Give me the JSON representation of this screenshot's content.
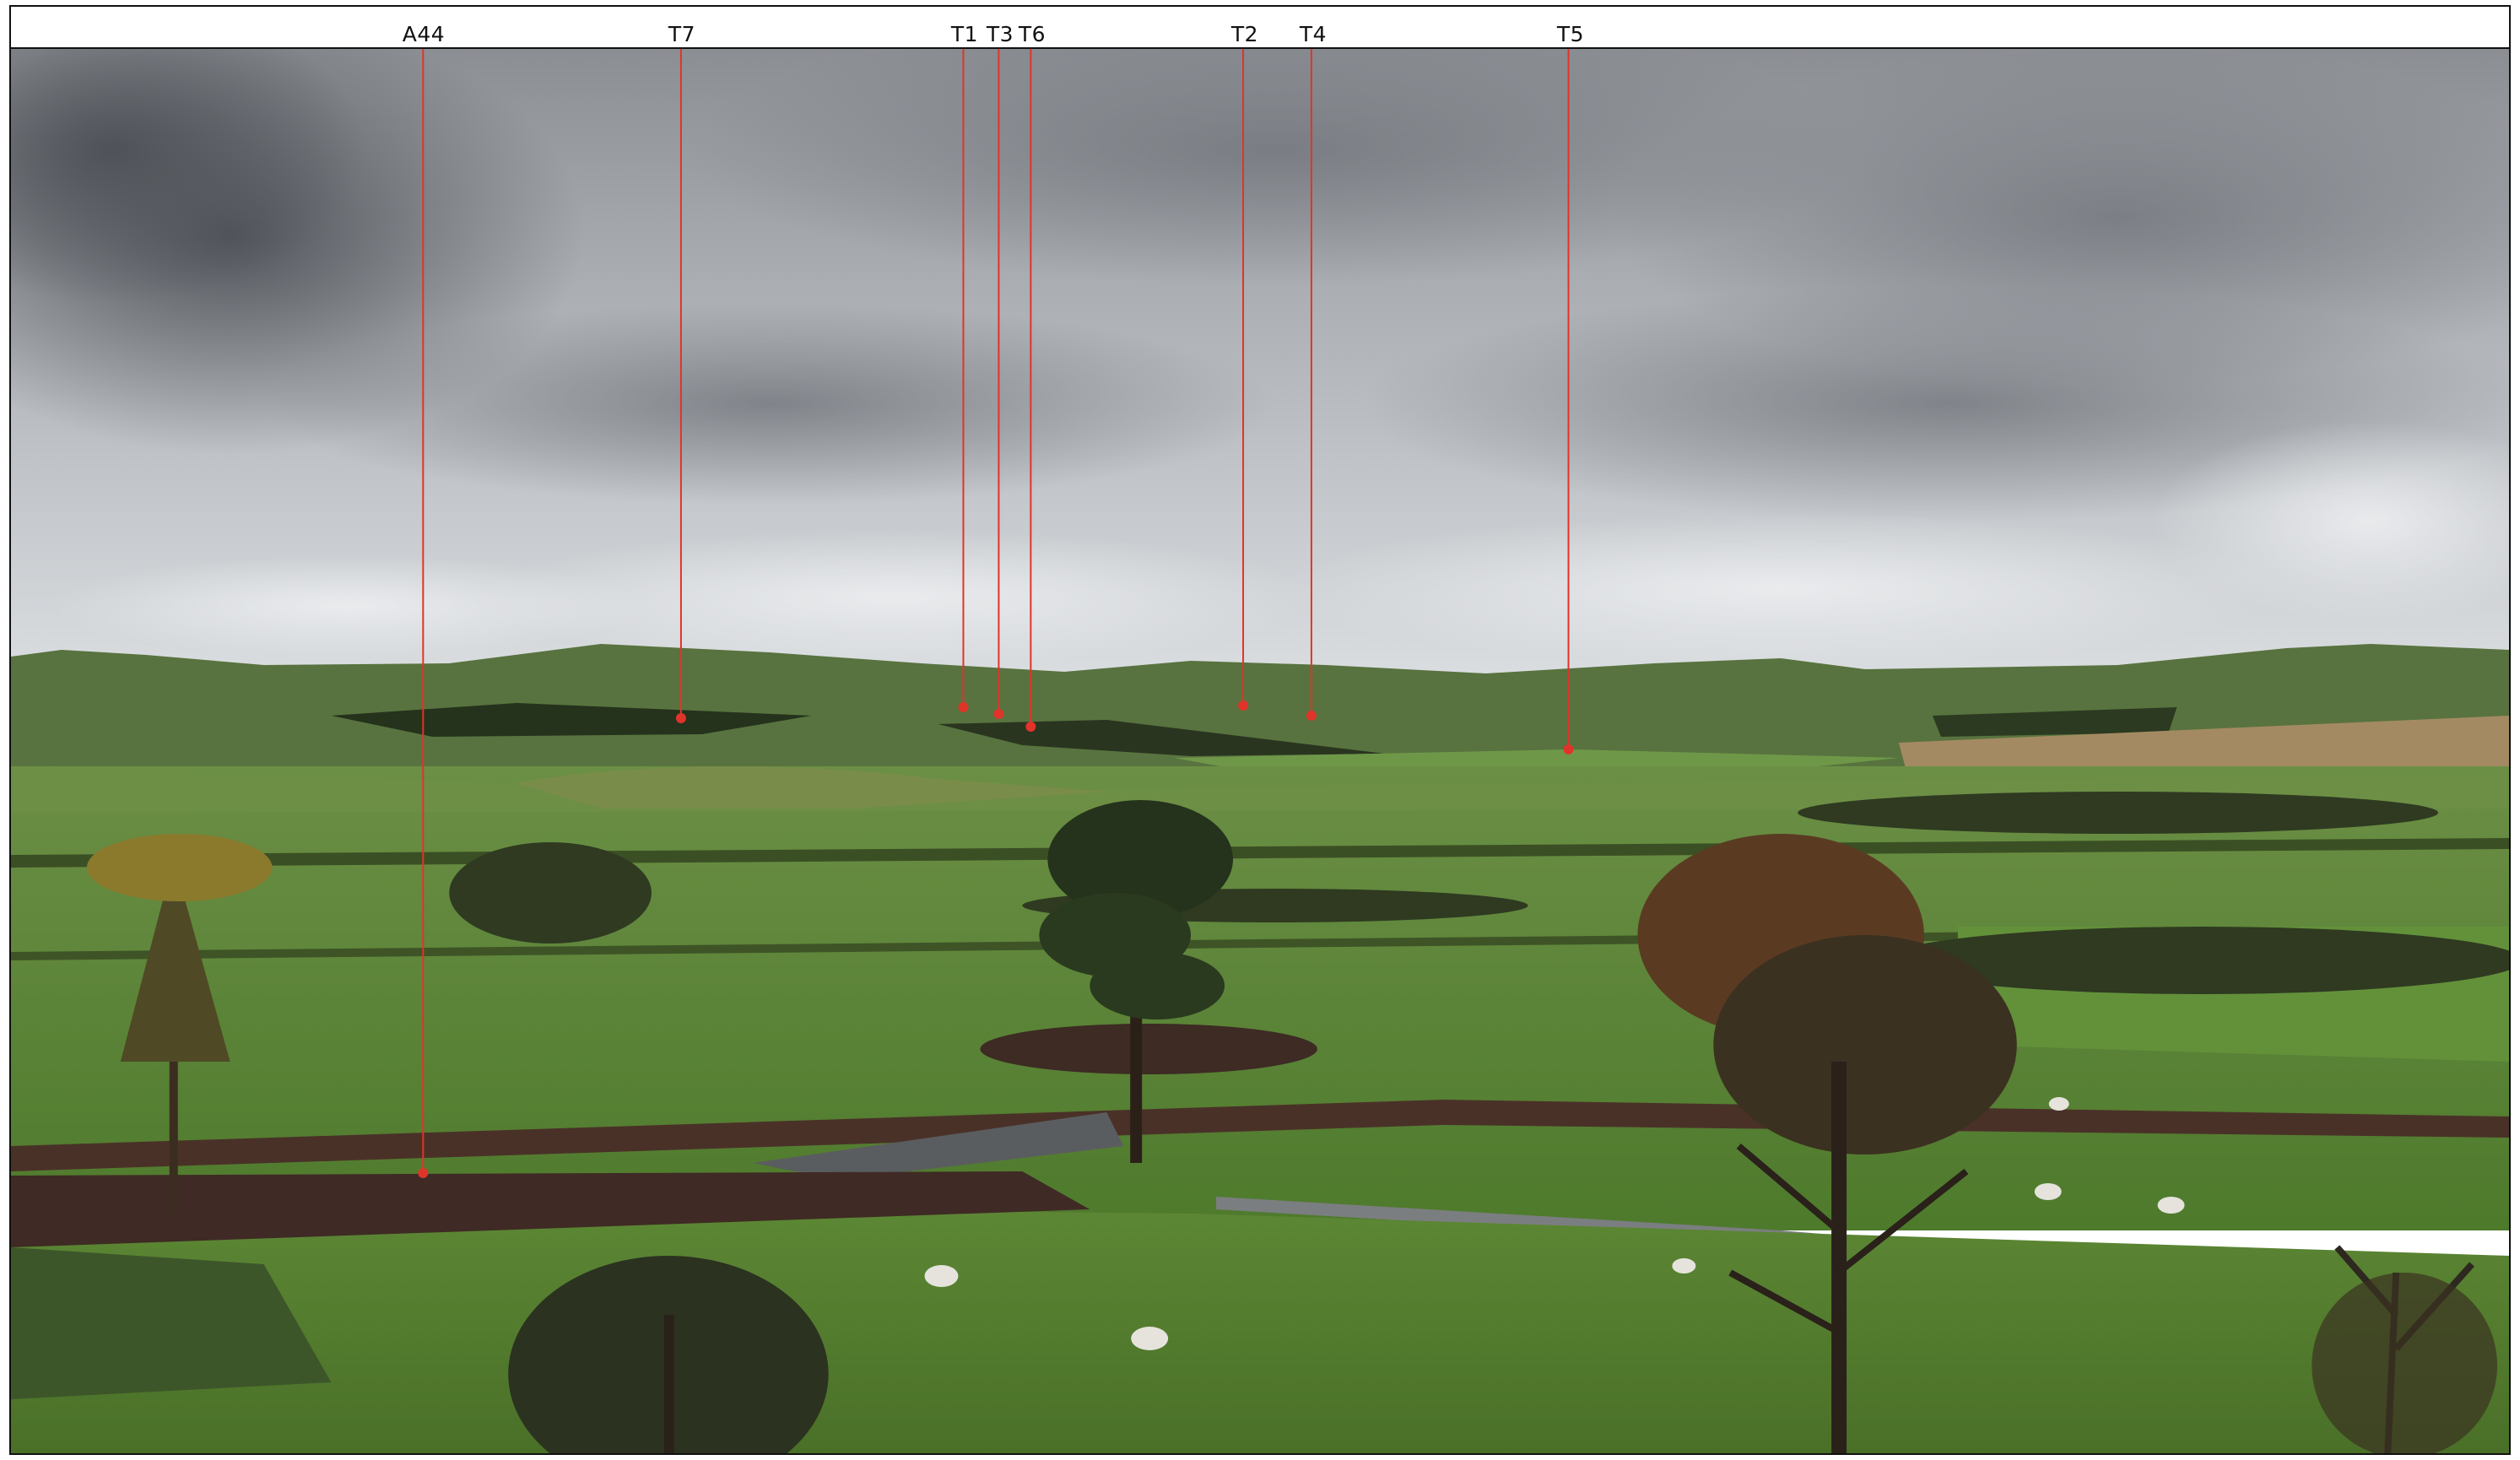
{
  "markers": [
    {
      "id": "A44",
      "label": "A44"
    },
    {
      "id": "T7",
      "label": "T7"
    },
    {
      "id": "T1",
      "label": "T1"
    },
    {
      "id": "T3",
      "label": "T3"
    },
    {
      "id": "T6",
      "label": "T6"
    },
    {
      "id": "T2",
      "label": "T2"
    },
    {
      "id": "T4",
      "label": "T4"
    },
    {
      "id": "T5",
      "label": "T5"
    }
  ],
  "colors": {
    "marker_line": "#e0342a",
    "frame": "#111111",
    "sky_top": "#7c7f85",
    "sky_mid": "#b9bcc1",
    "sky_horizon": "#d9dcdf",
    "hills_far": "#5d7a45",
    "field_green": "#5f8a3a",
    "field_dark": "#3e5b25",
    "hedge": "#4a3128"
  },
  "scene": "panoramic-photograph"
}
